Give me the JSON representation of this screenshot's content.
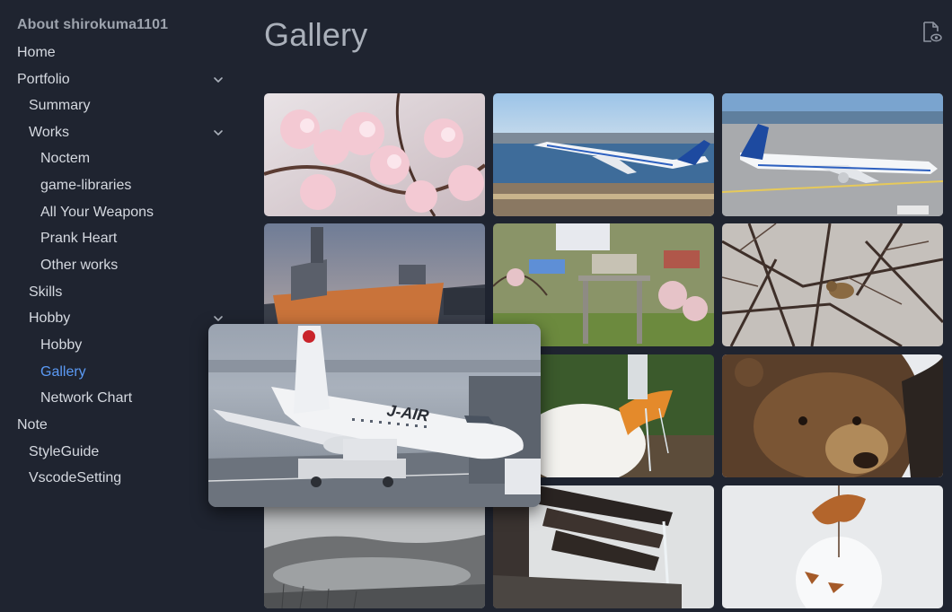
{
  "sidebar": {
    "site_title": "About shirokuma1101",
    "items": [
      {
        "label": "Home"
      },
      {
        "label": "Portfolio"
      },
      {
        "label": "Summary"
      },
      {
        "label": "Works"
      },
      {
        "label": "Noctem"
      },
      {
        "label": "game-libraries"
      },
      {
        "label": "All Your Weapons"
      },
      {
        "label": "Prank Heart"
      },
      {
        "label": "Other works"
      },
      {
        "label": "Skills"
      },
      {
        "label": "Hobby"
      },
      {
        "label": "Hobby"
      },
      {
        "label": "Gallery"
      },
      {
        "label": "Network Chart"
      },
      {
        "label": "Note"
      },
      {
        "label": "StyleGuide"
      },
      {
        "label": "VscodeSetting"
      }
    ],
    "active_item": "Gallery"
  },
  "main": {
    "title": "Gallery",
    "edit_icon": "file-eye-icon",
    "gallery": [
      {
        "subject": "cherry-blossoms"
      },
      {
        "subject": "ana-airplane-takeoff"
      },
      {
        "subject": "ana-airplane-taxiing"
      },
      {
        "subject": "warship-at-dusk"
      },
      {
        "subject": "shrine-torii-town"
      },
      {
        "subject": "bird-in-branches"
      },
      {
        "subject": "jair-airplane-snow"
      },
      {
        "subject": "duck-drinking-water"
      },
      {
        "subject": "brown-bear"
      },
      {
        "subject": "misty-caldera-lake"
      },
      {
        "subject": "water-spout-fountain"
      },
      {
        "subject": "snowball-with-leaf"
      }
    ],
    "preview": {
      "subject": "jair-airplane-snow",
      "livery_text": "J-AIR"
    }
  },
  "colors": {
    "background": "#1f2430",
    "accent": "#5b9af5",
    "text": "#d5d9e0",
    "muted": "#9da3ad"
  }
}
